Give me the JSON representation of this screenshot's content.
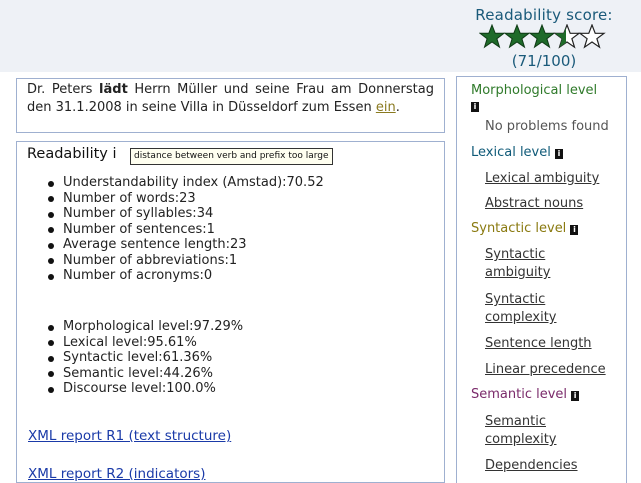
{
  "score": {
    "title": "Readability score:",
    "stars_full": 3.5,
    "stars_total": 5,
    "value_text": "(71/100)",
    "star_color": "#1f6b2a"
  },
  "sentence": {
    "part1": "Dr. Peters ",
    "bold": "lädt",
    "part2": " Herrn Müller und seine Frau am Donnerstag den 31.1.2008 in seine Villa in Düsseldorf zum Essen ",
    "link": "ein",
    "end": "."
  },
  "info": {
    "title": "Readability i",
    "tooltip": "distance between verb and prefix too large",
    "list1": [
      "Understandability index (Amstad):70.52",
      "Number of words:23",
      "Number of syllables:34",
      "Number of sentences:1",
      "Average sentence length:23",
      "Number of abbreviations:1",
      "Number of acronyms:0"
    ],
    "list2": [
      "Morphological level:97.29%",
      "Lexical level:95.61%",
      "Syntactic level:61.36%",
      "Semantic level:44.26%",
      "Discourse level:100.0%"
    ],
    "xml1": "XML report R1 (text structure)",
    "xml2": "XML report R2 (indicators)"
  },
  "side": {
    "morph_title": "Morphological level",
    "morph_status": "No problems found",
    "lex_title": "Lexical level",
    "lex_items": [
      "Lexical ambiguity",
      "Abstract nouns"
    ],
    "syn_title": "Syntactic level",
    "syn_items": [
      "Syntactic ambiguity",
      "Syntactic complexity",
      "Sentence length",
      "Linear precedence"
    ],
    "sem_title": "Semantic level",
    "sem_items": [
      "Semantic complexity",
      "Dependencies"
    ],
    "colors": {
      "morph": "#2f7a2a",
      "lex": "#0f5a78",
      "syn": "#8a7a10",
      "sem": "#7a2a6a"
    }
  }
}
